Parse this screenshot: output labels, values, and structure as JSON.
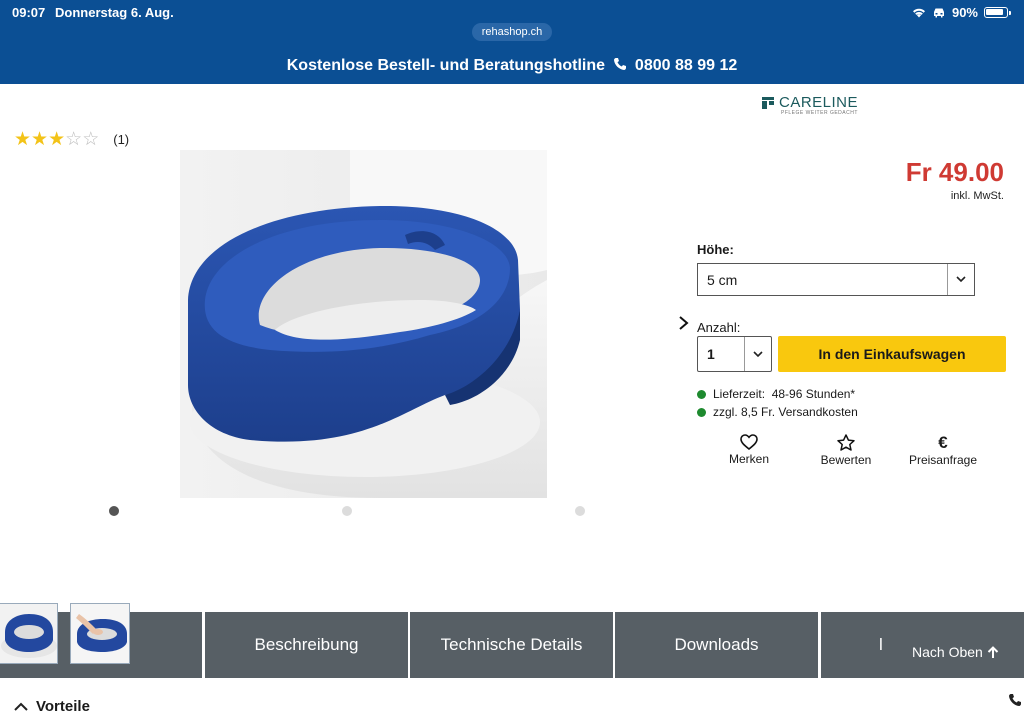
{
  "status_bar": {
    "time": "09:07",
    "date": "Donnerstag 6. Aug.",
    "battery": "90%"
  },
  "browser": {
    "url": "rehashop.ch"
  },
  "header": {
    "hotline_text": "Kostenlose Bestell- und Beratungshotline",
    "hotline_number": "0800 88 99 12"
  },
  "brand": {
    "name": "CARELINE",
    "tagline": "PFLEGE WEITER GEDACHT"
  },
  "rating": {
    "stars_filled": 3,
    "stars_total": 5,
    "count": "(1)"
  },
  "product": {
    "price": "Fr 49.00",
    "vat_note": "inkl. MwSt.",
    "gallery_active_index": 0
  },
  "options": {
    "height_label": "Höhe:",
    "height_value": "5 cm",
    "quantity_label": "Anzahl:",
    "quantity_value": "1",
    "cart_button": "In den Einkaufswagen"
  },
  "delivery": {
    "lead_time": "Lieferzeit:  48-96 Stunden*",
    "shipping": "zzgl. 8,5 Fr. Versandkosten"
  },
  "actions": [
    {
      "label": "Merken",
      "icon": "heart-icon"
    },
    {
      "label": "Bewerten",
      "icon": "star-icon"
    },
    {
      "label": "Preisanfrage",
      "icon": "euro-icon"
    }
  ],
  "tabs": [
    {
      "label": "Beschreibung"
    },
    {
      "label": "Technische Details"
    },
    {
      "label": "Downloads"
    }
  ],
  "scroll_top": {
    "label": "Nach Oben"
  },
  "section": {
    "title": "Vorteile"
  },
  "colors": {
    "header_blue": "#0b4f94",
    "price_red": "#cf3a33",
    "cart_yellow": "#f9c80e",
    "tab_grey": "#575f65",
    "star_gold": "#f3c318"
  }
}
